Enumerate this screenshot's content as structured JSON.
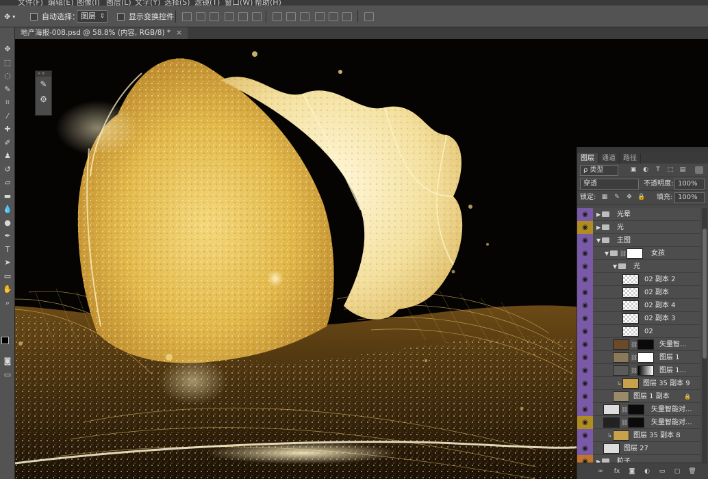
{
  "menu": [
    "文件(F)",
    "编辑(E)",
    "图像(I)",
    "图层(L)",
    "文字(Y)",
    "选择(S)",
    "滤镜(T)",
    "窗口(W)",
    "帮助(H)"
  ],
  "options": {
    "auto_select_label": "自动选择：",
    "auto_select_value": "图层",
    "show_transform_label": "显示变换控件"
  },
  "document_tab": {
    "title": "地产海报-008.psd @ 58.8% (内容, RGB/8) *",
    "close": "×"
  },
  "layers_panel": {
    "tabs": [
      "图层",
      "通道",
      "路径"
    ],
    "filter_kind": "ρ 类型",
    "blend_mode": "穿透",
    "opacity_label": "不透明度:",
    "opacity_value": "100%",
    "lock_label": "锁定:",
    "fill_label": "填充:",
    "fill_value": "100%",
    "layers": [
      {
        "name": "光晕",
        "eye": "p"
      },
      {
        "name": "光",
        "eye": "y"
      },
      {
        "name": "主图",
        "eye": "p"
      },
      {
        "name": "女孩",
        "eye": "p"
      },
      {
        "name": "光",
        "eye": "p"
      },
      {
        "name": "02 副本 2",
        "eye": "p"
      },
      {
        "name": "02 副本",
        "eye": "p"
      },
      {
        "name": "02 副本 4",
        "eye": "p"
      },
      {
        "name": "02 副本 3",
        "eye": "p"
      },
      {
        "name": "02",
        "eye": "p"
      },
      {
        "name": "矢量智...",
        "eye": "p"
      },
      {
        "name": "图层 1",
        "eye": "p"
      },
      {
        "name": "图层 1...",
        "eye": "p"
      },
      {
        "name": "图层 35 副本 9",
        "eye": "p"
      },
      {
        "name": "图层 1 副本",
        "eye": "p"
      },
      {
        "name": "矢量智能对...",
        "eye": "p"
      },
      {
        "name": "矢量智能对...",
        "eye": "y"
      },
      {
        "name": "图层 35 副本 8",
        "eye": "p"
      },
      {
        "name": "图层 27",
        "eye": "p"
      },
      {
        "name": "粒子",
        "eye": "o"
      }
    ]
  },
  "colors": {
    "layer_eye_purple": "#7a5aa6",
    "layer_eye_yellow": "#b08d22",
    "layer_eye_orange": "#c0752c",
    "canvas_bg": "#060403",
    "glitter": "#e8c45a"
  }
}
